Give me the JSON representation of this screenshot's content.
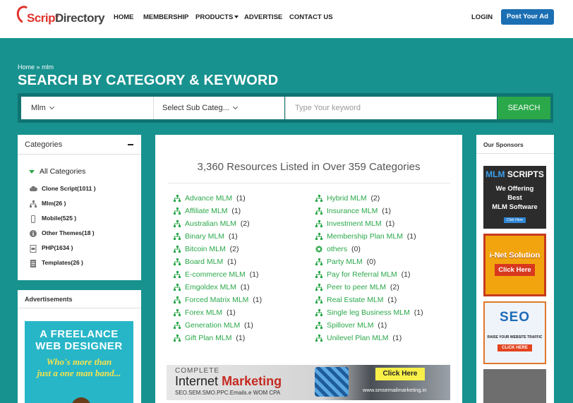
{
  "brand": {
    "logo_script": "Script",
    "logo_directory": "Directory"
  },
  "nav": {
    "home": "HOME",
    "membership": "MEMBERSHIP",
    "products": "PRODUCTS",
    "advertise": "ADVERTISE",
    "contact": "CONTACT US",
    "login": "LOGIN",
    "post_ad": "Post Your Ad"
  },
  "breadcrumb": {
    "home": "Home",
    "sep": "»",
    "current": "mlm"
  },
  "page_title": "SEARCH BY CATEGORY & KEYWORD",
  "search": {
    "category_value": "Mlm",
    "subcategory_value": "Select Sub Categ...",
    "keyword_placeholder": "Type Your keyword",
    "button": "SEARCH"
  },
  "sidebar": {
    "title": "Categories",
    "all": "All Categories",
    "items": [
      {
        "label": "Clone Script(1011 )",
        "icon": "cloud-icon"
      },
      {
        "label": "Mlm(26 )",
        "icon": "sitemap-icon"
      },
      {
        "label": "Mobile(525 )",
        "icon": "mobile-icon"
      },
      {
        "label": "Other Themes(18 )",
        "icon": "info-icon"
      },
      {
        "label": "PHP(1634 )",
        "icon": "php-icon"
      },
      {
        "label": "Templates(26 )",
        "icon": "document-icon"
      }
    ],
    "ads_title": "Advertisements",
    "ad_line1": "A FREELANCE",
    "ad_line2": "WEB DESIGNER",
    "ad_line3": "Who's more than",
    "ad_line4": "just a one man band..."
  },
  "main": {
    "summary": "3,360 Resources Listed in Over 359 Categories",
    "left": [
      {
        "label": "Advance MLM",
        "count": "(1)"
      },
      {
        "label": "Affiliate MLM",
        "count": "(1)"
      },
      {
        "label": "Australian MLM",
        "count": "(2)"
      },
      {
        "label": "Binary MLM",
        "count": "(1)"
      },
      {
        "label": "Bitcoin MLM",
        "count": "(2)"
      },
      {
        "label": "Board MLM",
        "count": "(1)"
      },
      {
        "label": "E-commerce MLM",
        "count": "(1)"
      },
      {
        "label": "Emgoldex MLM",
        "count": "(1)"
      },
      {
        "label": "Forced Matrix MLM",
        "count": "(1)"
      },
      {
        "label": "Forex MLM",
        "count": "(1)"
      },
      {
        "label": "Generation MLM",
        "count": "(1)"
      },
      {
        "label": "Gift Plan MLM",
        "count": "(1)"
      }
    ],
    "right": [
      {
        "label": "Hybrid MLM",
        "count": "(2)",
        "icon": "sitemap-icon"
      },
      {
        "label": "Insurance MLM",
        "count": "(1)",
        "icon": "sitemap-icon"
      },
      {
        "label": "Investment MLM",
        "count": "(1)",
        "icon": "sitemap-icon"
      },
      {
        "label": "Membership Plan MLM",
        "count": "(1)",
        "icon": "sitemap-icon"
      },
      {
        "label": "others",
        "count": "(0)",
        "icon": "gear-icon"
      },
      {
        "label": "Party MLM",
        "count": "(0)",
        "icon": "sitemap-icon"
      },
      {
        "label": "Pay for Referral MLM",
        "count": "(1)",
        "icon": "sitemap-icon"
      },
      {
        "label": "Peer to peer MLM",
        "count": "(2)",
        "icon": "sitemap-icon"
      },
      {
        "label": "Real Estate MLM",
        "count": "(1)",
        "icon": "sitemap-icon"
      },
      {
        "label": "Single leg Business MLM",
        "count": "(1)",
        "icon": "sitemap-icon"
      },
      {
        "label": "Spillover MLM",
        "count": "(1)",
        "icon": "sitemap-icon"
      },
      {
        "label": "Unilevel Plan MLM",
        "count": "(1)",
        "icon": "sitemap-icon"
      }
    ],
    "banner": {
      "complete": "COMPLETE",
      "internet": "Internet",
      "marketing": "Marketing",
      "sub": "SEO.SEM.SMO.PPC.Emails.e WOM CPA",
      "click": "Click Here",
      "url": "www.smsemailmarketing.in"
    }
  },
  "sponsors": {
    "title": "Our Sponsors",
    "s1_a": "MLM",
    "s1_b": "SCRIPTS",
    "s1_c": "We Offering",
    "s1_d": "Best",
    "s1_e": "MLM Software",
    "s1_btn": "Click Here",
    "s2_title": "i-Net Solution",
    "s2_btn": "Click Here",
    "s3_title": "SEO",
    "s3_sub": "RAISE YOUR WEBSITE TRAFFIC",
    "s3_btn": "CLICK HERE"
  },
  "colors": {
    "teal": "#17928f",
    "green": "#2ba84a",
    "post_ad_blue": "#1b6fb3",
    "logo_red": "#e0332c"
  }
}
